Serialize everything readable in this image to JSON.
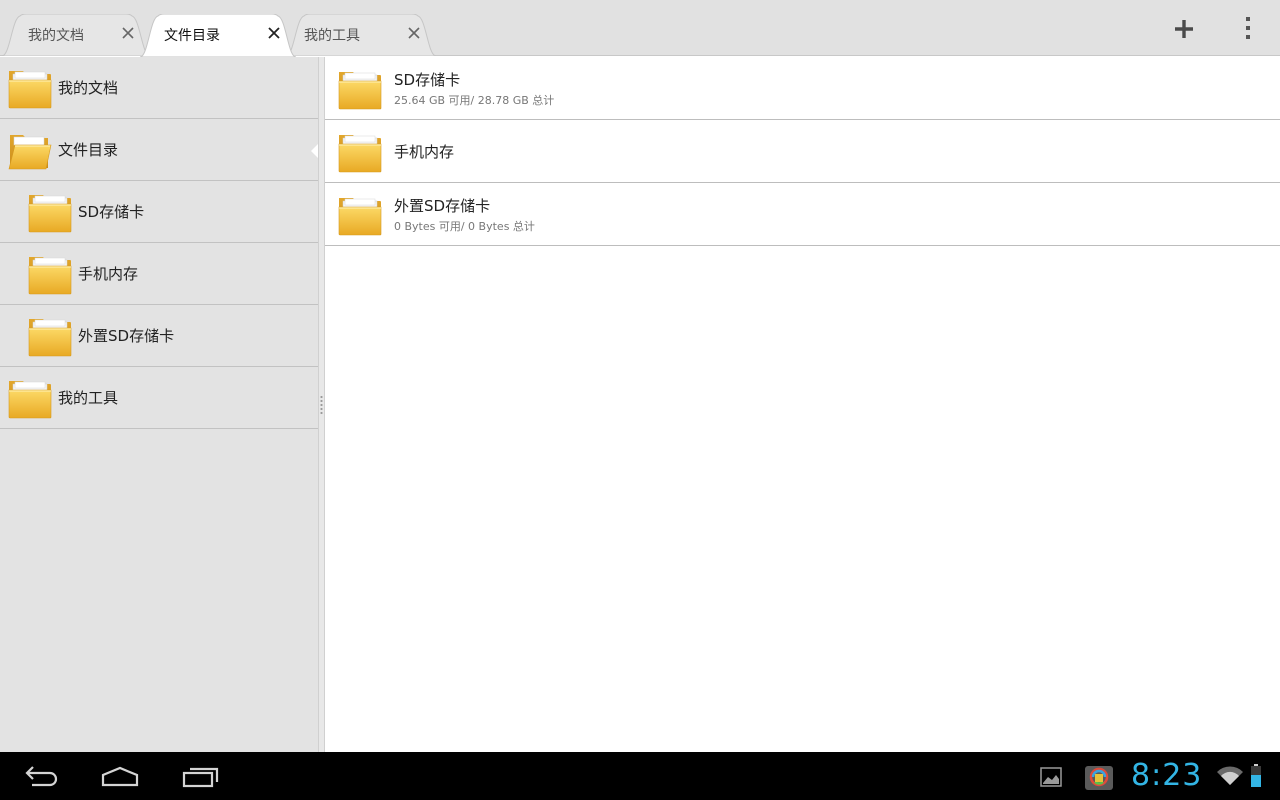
{
  "tabs": [
    {
      "label": "我的文档",
      "active": false
    },
    {
      "label": "文件目录",
      "active": true
    },
    {
      "label": "我的工具",
      "active": false
    }
  ],
  "actions": {
    "add_icon": "plus-icon",
    "overflow_icon": "overflow-menu-icon"
  },
  "tree": [
    {
      "label": "我的文档",
      "level": 0,
      "icon": "folder-icon"
    },
    {
      "label": "文件目录",
      "level": 0,
      "icon": "open-folder-icon",
      "selected": true
    },
    {
      "label": "SD存储卡",
      "level": 1,
      "icon": "folder-icon"
    },
    {
      "label": "手机内存",
      "level": 1,
      "icon": "folder-icon"
    },
    {
      "label": "外置SD存储卡",
      "level": 1,
      "icon": "folder-icon"
    },
    {
      "label": "我的工具",
      "level": 0,
      "icon": "folder-icon"
    }
  ],
  "files": [
    {
      "name": "SD存储卡",
      "info": "25.64 GB 可用/ 28.78 GB 总计"
    },
    {
      "name": "手机内存",
      "info": ""
    },
    {
      "name": "外置SD存储卡",
      "info": "0 Bytes 可用/ 0 Bytes 总计"
    }
  ],
  "statusbar": {
    "time": "8:23",
    "accent_color": "#33b5e5"
  },
  "colors": {
    "folder": "#f2c23a",
    "panel_bg": "#e3e3e3",
    "tabbar_bg": "#e1e1e1"
  }
}
